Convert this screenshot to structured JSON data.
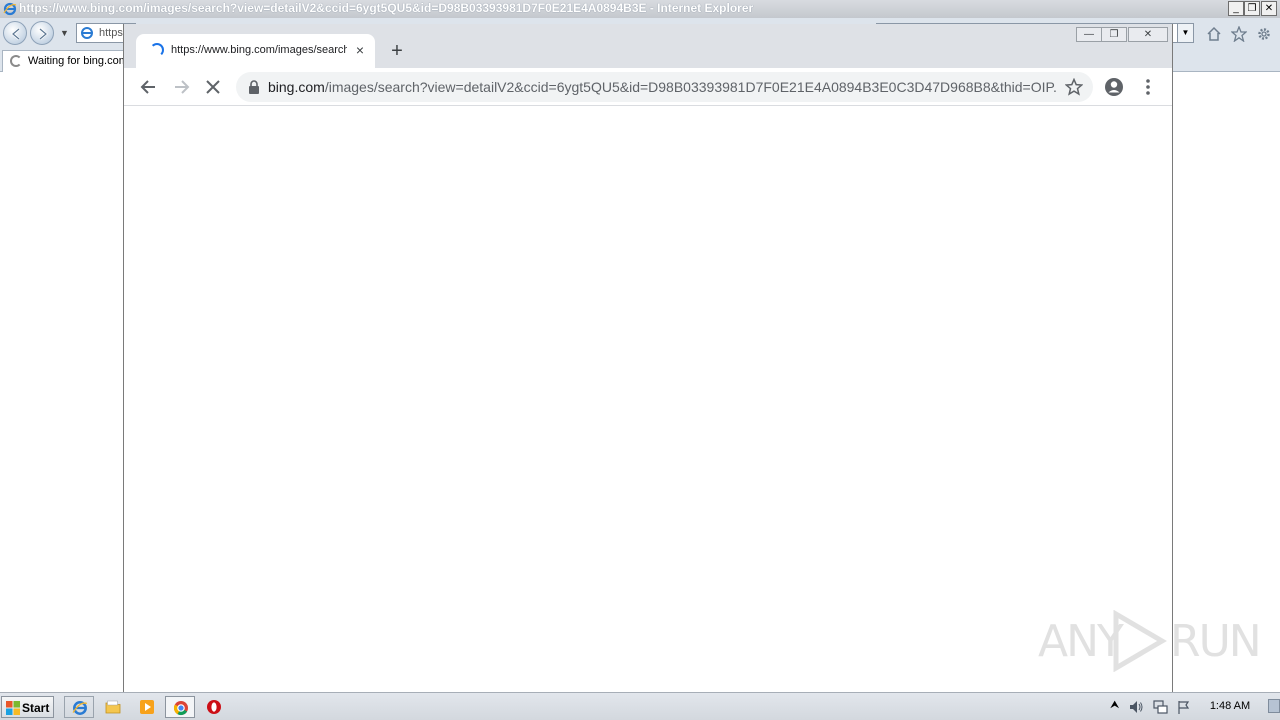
{
  "ie": {
    "title": "https://www.bing.com/images/search?view=detailV2&ccid=6ygt5QU5&id=D98B03393981D7F0E21E4A0894B3E - Internet Explorer",
    "address_text": "https",
    "tab_label": "Waiting for bing.com"
  },
  "chrome": {
    "tab_title": "https://www.bing.com/images/search",
    "tab_close": "×",
    "new_tab": "+",
    "url_host": "bing.com",
    "url_path": "/images/search?view=detailV2&ccid=6ygt5QU5&id=D98B03393981D7F0E21E4A0894B3E0C3D47D968B8&thid=OIP...."
  },
  "watermark": {
    "left": "ANY",
    "right": "RUN"
  },
  "taskbar": {
    "start_label": "Start",
    "clock": "1:48 AM"
  },
  "colors": {
    "chrome_accent": "#1a73e8",
    "chrome_tabstrip": "#dee1e6",
    "ie_frame": "#dde4ec"
  }
}
